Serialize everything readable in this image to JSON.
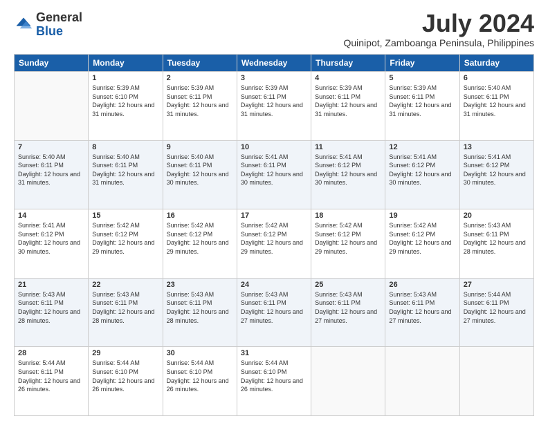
{
  "logo": {
    "general": "General",
    "blue": "Blue"
  },
  "title": "July 2024",
  "subtitle": "Quinipot, Zamboanga Peninsula, Philippines",
  "days_header": [
    "Sunday",
    "Monday",
    "Tuesday",
    "Wednesday",
    "Thursday",
    "Friday",
    "Saturday"
  ],
  "weeks": [
    [
      {
        "day": "",
        "sunrise": "",
        "sunset": "",
        "daylight": ""
      },
      {
        "day": "1",
        "sunrise": "Sunrise: 5:39 AM",
        "sunset": "Sunset: 6:10 PM",
        "daylight": "Daylight: 12 hours and 31 minutes."
      },
      {
        "day": "2",
        "sunrise": "Sunrise: 5:39 AM",
        "sunset": "Sunset: 6:11 PM",
        "daylight": "Daylight: 12 hours and 31 minutes."
      },
      {
        "day": "3",
        "sunrise": "Sunrise: 5:39 AM",
        "sunset": "Sunset: 6:11 PM",
        "daylight": "Daylight: 12 hours and 31 minutes."
      },
      {
        "day": "4",
        "sunrise": "Sunrise: 5:39 AM",
        "sunset": "Sunset: 6:11 PM",
        "daylight": "Daylight: 12 hours and 31 minutes."
      },
      {
        "day": "5",
        "sunrise": "Sunrise: 5:39 AM",
        "sunset": "Sunset: 6:11 PM",
        "daylight": "Daylight: 12 hours and 31 minutes."
      },
      {
        "day": "6",
        "sunrise": "Sunrise: 5:40 AM",
        "sunset": "Sunset: 6:11 PM",
        "daylight": "Daylight: 12 hours and 31 minutes."
      }
    ],
    [
      {
        "day": "7",
        "sunrise": "Sunrise: 5:40 AM",
        "sunset": "Sunset: 6:11 PM",
        "daylight": "Daylight: 12 hours and 31 minutes."
      },
      {
        "day": "8",
        "sunrise": "Sunrise: 5:40 AM",
        "sunset": "Sunset: 6:11 PM",
        "daylight": "Daylight: 12 hours and 31 minutes."
      },
      {
        "day": "9",
        "sunrise": "Sunrise: 5:40 AM",
        "sunset": "Sunset: 6:11 PM",
        "daylight": "Daylight: 12 hours and 30 minutes."
      },
      {
        "day": "10",
        "sunrise": "Sunrise: 5:41 AM",
        "sunset": "Sunset: 6:11 PM",
        "daylight": "Daylight: 12 hours and 30 minutes."
      },
      {
        "day": "11",
        "sunrise": "Sunrise: 5:41 AM",
        "sunset": "Sunset: 6:12 PM",
        "daylight": "Daylight: 12 hours and 30 minutes."
      },
      {
        "day": "12",
        "sunrise": "Sunrise: 5:41 AM",
        "sunset": "Sunset: 6:12 PM",
        "daylight": "Daylight: 12 hours and 30 minutes."
      },
      {
        "day": "13",
        "sunrise": "Sunrise: 5:41 AM",
        "sunset": "Sunset: 6:12 PM",
        "daylight": "Daylight: 12 hours and 30 minutes."
      }
    ],
    [
      {
        "day": "14",
        "sunrise": "Sunrise: 5:41 AM",
        "sunset": "Sunset: 6:12 PM",
        "daylight": "Daylight: 12 hours and 30 minutes."
      },
      {
        "day": "15",
        "sunrise": "Sunrise: 5:42 AM",
        "sunset": "Sunset: 6:12 PM",
        "daylight": "Daylight: 12 hours and 29 minutes."
      },
      {
        "day": "16",
        "sunrise": "Sunrise: 5:42 AM",
        "sunset": "Sunset: 6:12 PM",
        "daylight": "Daylight: 12 hours and 29 minutes."
      },
      {
        "day": "17",
        "sunrise": "Sunrise: 5:42 AM",
        "sunset": "Sunset: 6:12 PM",
        "daylight": "Daylight: 12 hours and 29 minutes."
      },
      {
        "day": "18",
        "sunrise": "Sunrise: 5:42 AM",
        "sunset": "Sunset: 6:12 PM",
        "daylight": "Daylight: 12 hours and 29 minutes."
      },
      {
        "day": "19",
        "sunrise": "Sunrise: 5:42 AM",
        "sunset": "Sunset: 6:12 PM",
        "daylight": "Daylight: 12 hours and 29 minutes."
      },
      {
        "day": "20",
        "sunrise": "Sunrise: 5:43 AM",
        "sunset": "Sunset: 6:11 PM",
        "daylight": "Daylight: 12 hours and 28 minutes."
      }
    ],
    [
      {
        "day": "21",
        "sunrise": "Sunrise: 5:43 AM",
        "sunset": "Sunset: 6:11 PM",
        "daylight": "Daylight: 12 hours and 28 minutes."
      },
      {
        "day": "22",
        "sunrise": "Sunrise: 5:43 AM",
        "sunset": "Sunset: 6:11 PM",
        "daylight": "Daylight: 12 hours and 28 minutes."
      },
      {
        "day": "23",
        "sunrise": "Sunrise: 5:43 AM",
        "sunset": "Sunset: 6:11 PM",
        "daylight": "Daylight: 12 hours and 28 minutes."
      },
      {
        "day": "24",
        "sunrise": "Sunrise: 5:43 AM",
        "sunset": "Sunset: 6:11 PM",
        "daylight": "Daylight: 12 hours and 27 minutes."
      },
      {
        "day": "25",
        "sunrise": "Sunrise: 5:43 AM",
        "sunset": "Sunset: 6:11 PM",
        "daylight": "Daylight: 12 hours and 27 minutes."
      },
      {
        "day": "26",
        "sunrise": "Sunrise: 5:43 AM",
        "sunset": "Sunset: 6:11 PM",
        "daylight": "Daylight: 12 hours and 27 minutes."
      },
      {
        "day": "27",
        "sunrise": "Sunrise: 5:44 AM",
        "sunset": "Sunset: 6:11 PM",
        "daylight": "Daylight: 12 hours and 27 minutes."
      }
    ],
    [
      {
        "day": "28",
        "sunrise": "Sunrise: 5:44 AM",
        "sunset": "Sunset: 6:11 PM",
        "daylight": "Daylight: 12 hours and 26 minutes."
      },
      {
        "day": "29",
        "sunrise": "Sunrise: 5:44 AM",
        "sunset": "Sunset: 6:10 PM",
        "daylight": "Daylight: 12 hours and 26 minutes."
      },
      {
        "day": "30",
        "sunrise": "Sunrise: 5:44 AM",
        "sunset": "Sunset: 6:10 PM",
        "daylight": "Daylight: 12 hours and 26 minutes."
      },
      {
        "day": "31",
        "sunrise": "Sunrise: 5:44 AM",
        "sunset": "Sunset: 6:10 PM",
        "daylight": "Daylight: 12 hours and 26 minutes."
      },
      {
        "day": "",
        "sunrise": "",
        "sunset": "",
        "daylight": ""
      },
      {
        "day": "",
        "sunrise": "",
        "sunset": "",
        "daylight": ""
      },
      {
        "day": "",
        "sunrise": "",
        "sunset": "",
        "daylight": ""
      }
    ]
  ]
}
